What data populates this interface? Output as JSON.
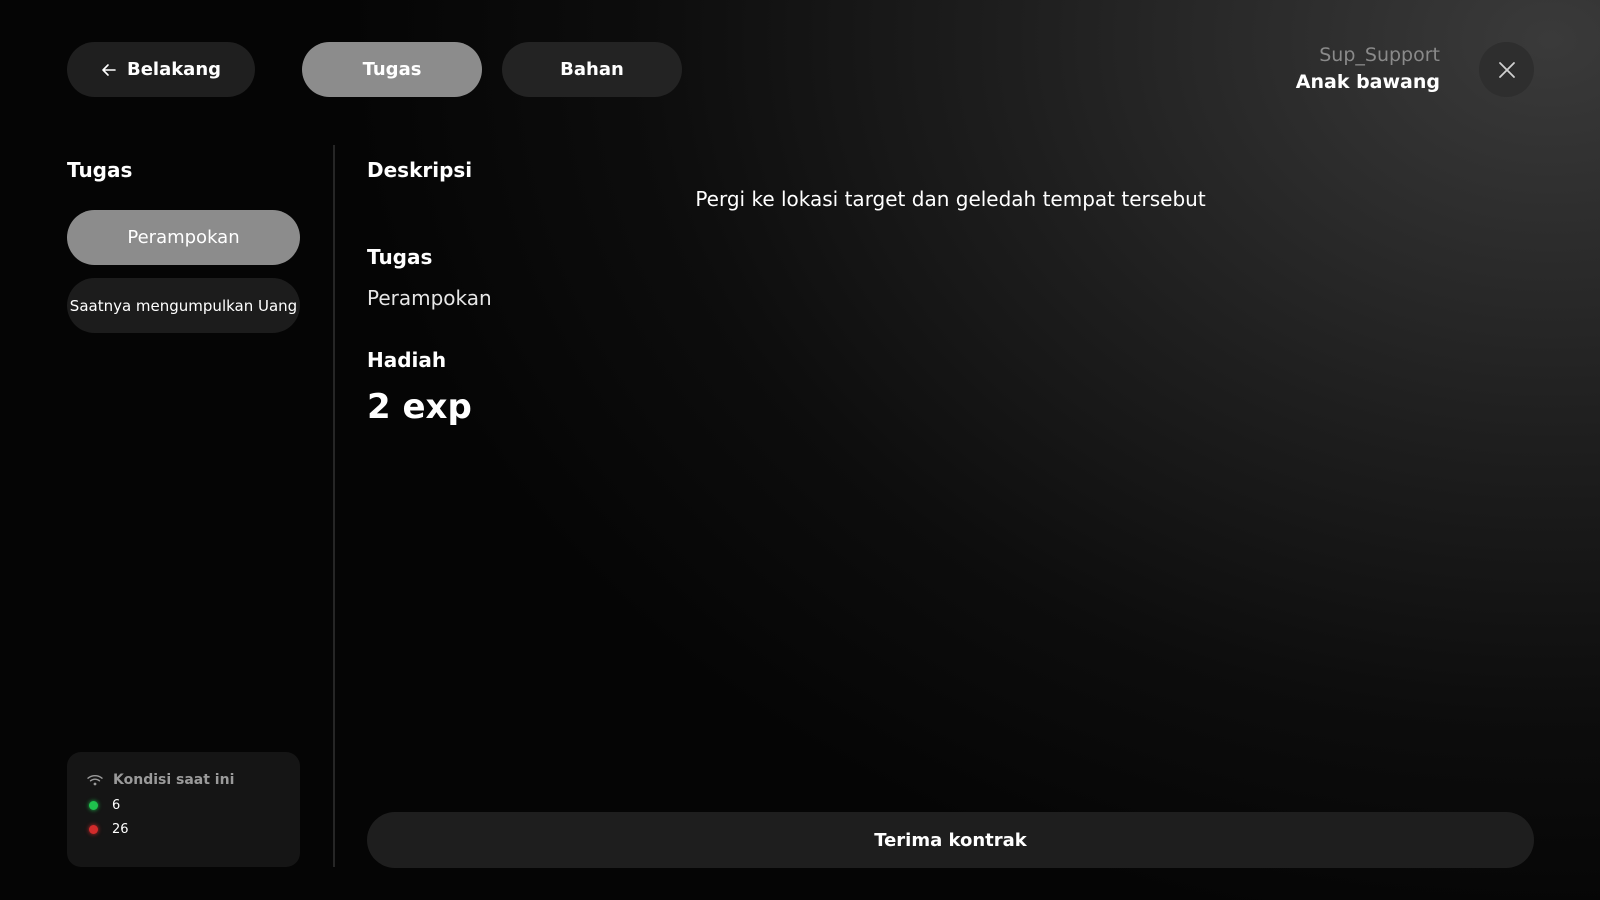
{
  "header": {
    "back_label": "Belakang",
    "tabs": [
      {
        "label": "Tugas",
        "active": true
      },
      {
        "label": "Bahan",
        "active": false
      }
    ],
    "user_role": "Sup_Support",
    "user_name": "Anak bawang"
  },
  "sidebar": {
    "title": "Tugas",
    "items": [
      {
        "label": "Perampokan",
        "active": true
      },
      {
        "label": "Saatnya mengumpulkan Uang",
        "active": false
      }
    ],
    "status": {
      "title": "Kondisi saat ini",
      "green_count": "6",
      "red_count": "26"
    }
  },
  "main": {
    "description_label": "Deskripsi",
    "description_text": "Pergi ke lokasi target dan geledah tempat tersebut",
    "task_label": "Tugas",
    "task_value": "Perampokan",
    "reward_label": "Hadiah",
    "reward_value": "2 exp",
    "accept_label": "Terima kontrak"
  },
  "colors": {
    "active_pill": "#8c8c8c",
    "inactive_pill": "#232323",
    "status_green": "#1fc24d",
    "status_red": "#d22b2b"
  },
  "icons": {
    "back": "arrow-left-icon",
    "close": "close-icon",
    "status": "wifi-icon"
  }
}
